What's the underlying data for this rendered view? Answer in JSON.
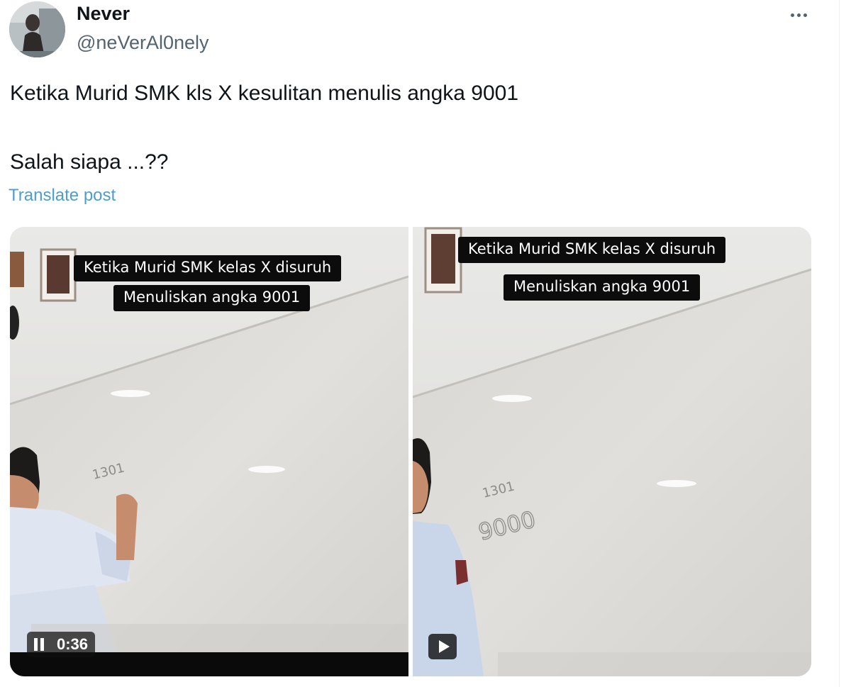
{
  "author": {
    "display_name": "Never",
    "handle": "@neVerAl0nely",
    "avatar_icon": "profile-photo"
  },
  "more_menu_icon": "ellipsis-icon",
  "post": {
    "text_line1": "Ketika Murid SMK kls X kesulitan menulis angka 9001",
    "text_line2": "Salah siapa ...??",
    "translate_label": "Translate post"
  },
  "media": [
    {
      "caption_line1": "Ketika Murid SMK kelas X disuruh",
      "caption_line2": "Menuliskan angka 9001",
      "control": "pause-icon",
      "time": "0:36",
      "whiteboard_writing": [
        "1301"
      ]
    },
    {
      "caption_line1": "Ketika Murid SMK kelas X disuruh",
      "caption_line2": "Menuliskan angka 9001",
      "control": "play-icon",
      "whiteboard_writing": [
        "1301",
        "9000"
      ]
    }
  ],
  "colors": {
    "text_primary": "#0f1419",
    "text_secondary": "#536471",
    "link": "#4d9dd1",
    "caption_bg": "#0c0c0c"
  }
}
